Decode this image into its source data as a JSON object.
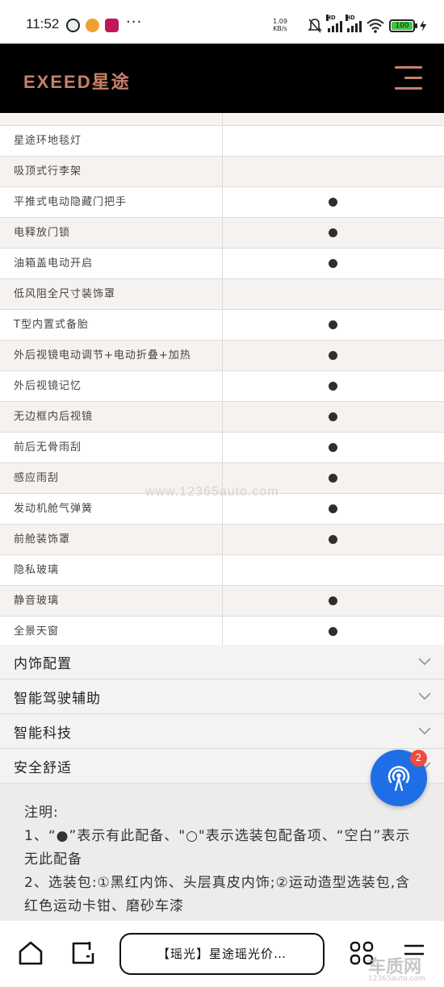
{
  "status_bar": {
    "time": "11:52",
    "more": "···",
    "net_speed_value": "1.09",
    "net_speed_unit": "KB/s",
    "signal_1_label": "HD",
    "signal_2_label": "HD",
    "battery": "100"
  },
  "header": {
    "logo": "EXEED星途"
  },
  "table": {
    "rows": [
      {
        "label": "",
        "has_dot": false
      },
      {
        "label": "星途环地毯灯",
        "has_dot": false
      },
      {
        "label": "吸顶式行李架",
        "has_dot": false
      },
      {
        "label": "平推式电动隐藏门把手",
        "has_dot": true
      },
      {
        "label": "电释放门锁",
        "has_dot": true
      },
      {
        "label": "油箱盖电动开启",
        "has_dot": true
      },
      {
        "label": "低风阻全尺寸装饰罩",
        "has_dot": false
      },
      {
        "label": "T型内置式备胎",
        "has_dot": true
      },
      {
        "label": "外后视镜电动调节+电动折叠+加热",
        "has_dot": true
      },
      {
        "label": "外后视镜记忆",
        "has_dot": true
      },
      {
        "label": "无边框内后视镜",
        "has_dot": true
      },
      {
        "label": "前后无骨雨刮",
        "has_dot": true
      },
      {
        "label": "感应雨刮",
        "has_dot": true
      },
      {
        "label": "发动机舱气弹簧",
        "has_dot": true
      },
      {
        "label": "前舱装饰罩",
        "has_dot": true
      },
      {
        "label": "隐私玻璃",
        "has_dot": false
      },
      {
        "label": "静音玻璃",
        "has_dot": true
      },
      {
        "label": "全景天窗",
        "has_dot": true
      }
    ]
  },
  "sections": [
    {
      "label": "内饰配置"
    },
    {
      "label": "智能驾驶辅助"
    },
    {
      "label": "智能科技"
    },
    {
      "label": "安全舒适"
    }
  ],
  "notes": {
    "title": "注明:",
    "line1": "1、“●”表示有此配备、\"○\"表示选装包配备项、“空白”表示无此配备",
    "line2": "2、选装包:①黑红内饰、头层真皮内饰;②运动造型选装包,含红色运动卡钳、磨砂车漆"
  },
  "fab": {
    "badge": "2"
  },
  "bottom_bar": {
    "page_title": "【瑶光】星途瑶光价…"
  },
  "watermark": {
    "center": "www.12365auto.com",
    "corner_main": "车质网",
    "corner_sub": "12365auto.com"
  },
  "colors": {
    "header_bg": "#000000",
    "brand_accent": "#c8806a",
    "fab_blue": "#1e6fe6",
    "badge_red": "#ef4c3d",
    "row_alt": "#f5f2ef"
  }
}
